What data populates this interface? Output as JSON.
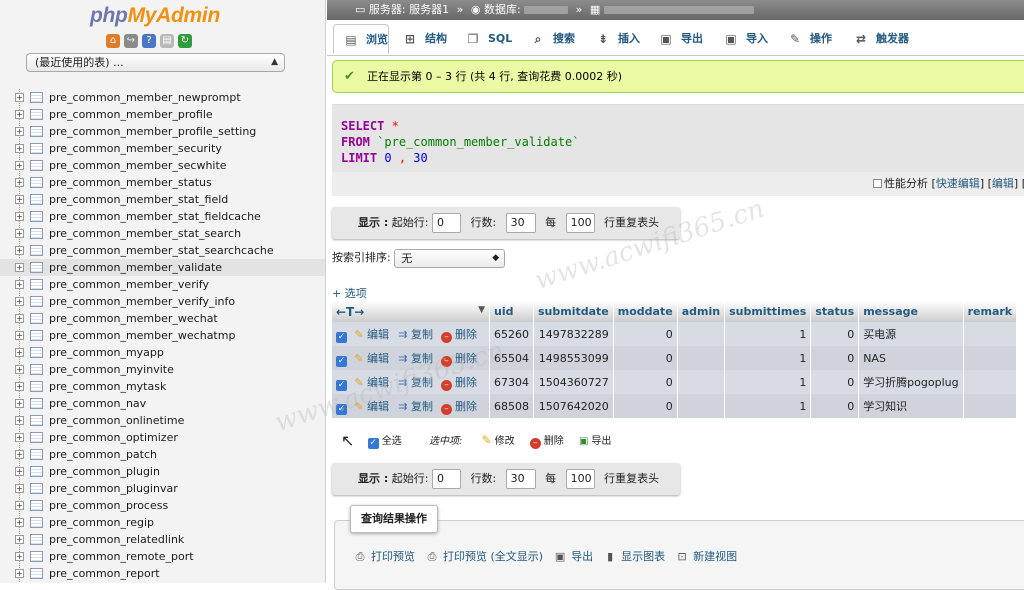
{
  "app": {
    "logo_part1": "php",
    "logo_part2": "MyAdmin"
  },
  "left": {
    "recent_select": "(最近使用的表) ...",
    "quick_icons": [
      "home-icon",
      "exit-icon",
      "help-icon",
      "docs-icon",
      "reload-icon"
    ],
    "tables": [
      "pre_common_member_newprompt",
      "pre_common_member_profile",
      "pre_common_member_profile_setting",
      "pre_common_member_security",
      "pre_common_member_secwhite",
      "pre_common_member_status",
      "pre_common_member_stat_field",
      "pre_common_member_stat_fieldcache",
      "pre_common_member_stat_search",
      "pre_common_member_stat_searchcache",
      "pre_common_member_validate",
      "pre_common_member_verify",
      "pre_common_member_verify_info",
      "pre_common_member_wechat",
      "pre_common_member_wechatmp",
      "pre_common_myapp",
      "pre_common_myinvite",
      "pre_common_mytask",
      "pre_common_nav",
      "pre_common_onlinetime",
      "pre_common_optimizer",
      "pre_common_patch",
      "pre_common_plugin",
      "pre_common_pluginvar",
      "pre_common_process",
      "pre_common_regip",
      "pre_common_relatedlink",
      "pre_common_remote_port",
      "pre_common_report"
    ],
    "selected_index": 10
  },
  "breadcrumb": {
    "server_label": "服务器: 服务器1",
    "sep": "»",
    "db_label": "数据库:"
  },
  "tabs": [
    {
      "label": "浏览",
      "icon": "browse-icon"
    },
    {
      "label": "结构",
      "icon": "structure-icon"
    },
    {
      "label": "SQL",
      "icon": "sql-icon"
    },
    {
      "label": "搜索",
      "icon": "search-icon"
    },
    {
      "label": "插入",
      "icon": "insert-icon"
    },
    {
      "label": "导出",
      "icon": "export-icon"
    },
    {
      "label": "导入",
      "icon": "import-icon"
    },
    {
      "label": "操作",
      "icon": "wrench-icon"
    },
    {
      "label": "触发器",
      "icon": "trigger-icon"
    }
  ],
  "success_message": "正在显示第 0 – 3 行 (共 4 行, 查询花费 0.0002 秒)",
  "sql": {
    "kw_select": "SELECT",
    "star": "*",
    "kw_from": "FROM",
    "table": "`pre_common_member_validate`",
    "kw_limit": "LIMIT",
    "limit_start": "0",
    "comma": ",",
    "limit_count": "30"
  },
  "sql_links": {
    "profiling": "性能分析",
    "lb1": "[",
    "inline_edit": "快速编辑",
    "mid": "] [",
    "edit": "编辑",
    "tail": "] ["
  },
  "nav": {
    "show": "显示 :",
    "start_label": "起始行:",
    "start_value": "0",
    "rows_label": "行数:",
    "rows_value": "30",
    "every_label": "每",
    "repeat_value": "100",
    "repeat_label": "行重复表头"
  },
  "sort": {
    "label": "按索引排序:",
    "value": "无"
  },
  "options_toggle": "+ 选项",
  "table": {
    "arrows": "←T→",
    "columns": [
      "uid",
      "submitdate",
      "moddate",
      "admin",
      "submittimes",
      "status",
      "message",
      "remark"
    ],
    "rows": [
      {
        "uid": "65260",
        "submitdate": "1497832289",
        "moddate": "0",
        "admin": "",
        "submittimes": "1",
        "status": "0",
        "message": "买电源",
        "remark": ""
      },
      {
        "uid": "65504",
        "submitdate": "1498553099",
        "moddate": "0",
        "admin": "",
        "submittimes": "1",
        "status": "0",
        "message": "NAS",
        "remark": ""
      },
      {
        "uid": "67304",
        "submitdate": "1504360727",
        "moddate": "0",
        "admin": "",
        "submittimes": "1",
        "status": "0",
        "message": "学习折腾pogoplug",
        "remark": ""
      },
      {
        "uid": "68508",
        "submitdate": "1507642020",
        "moddate": "0",
        "admin": "",
        "submittimes": "1",
        "status": "0",
        "message": "学习知识",
        "remark": ""
      }
    ],
    "actions": {
      "edit": "编辑",
      "copy": "复制",
      "delete": "删除"
    }
  },
  "bulk": {
    "check_all": "全选",
    "with_selected": "选中项:",
    "edit": "修改",
    "delete": "删除",
    "export": "导出"
  },
  "result_ops": {
    "legend": "查询结果操作",
    "items": [
      "打印预览",
      "打印预览 (全文显示)",
      "导出",
      "显示图表",
      "新建视图"
    ]
  },
  "watermark_text": "www.acwifi365.cn",
  "colors": {
    "link": "#235a81",
    "success_bg": "#ebf8a4",
    "success_border": "#a2d246",
    "row_odd": "#d7dbe3",
    "row_even": "#cfd4dc",
    "keyword": "#990099"
  }
}
